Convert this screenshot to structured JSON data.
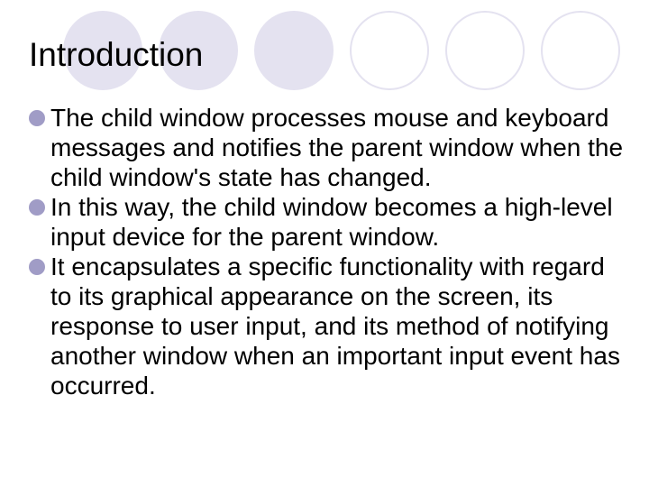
{
  "title": "Introduction",
  "bullets": [
    {
      "text": "The child window processes mouse and keyboard messages and notifies the parent window when the child window's state has changed."
    },
    {
      "text": "In this way, the child window becomes a high-level input device for the parent window."
    },
    {
      "text": "It encapsulates a specific functionality with regard to its graphical appearance on the screen, its response to user input, and its method of notifying another window when an important input event has occurred."
    }
  ]
}
